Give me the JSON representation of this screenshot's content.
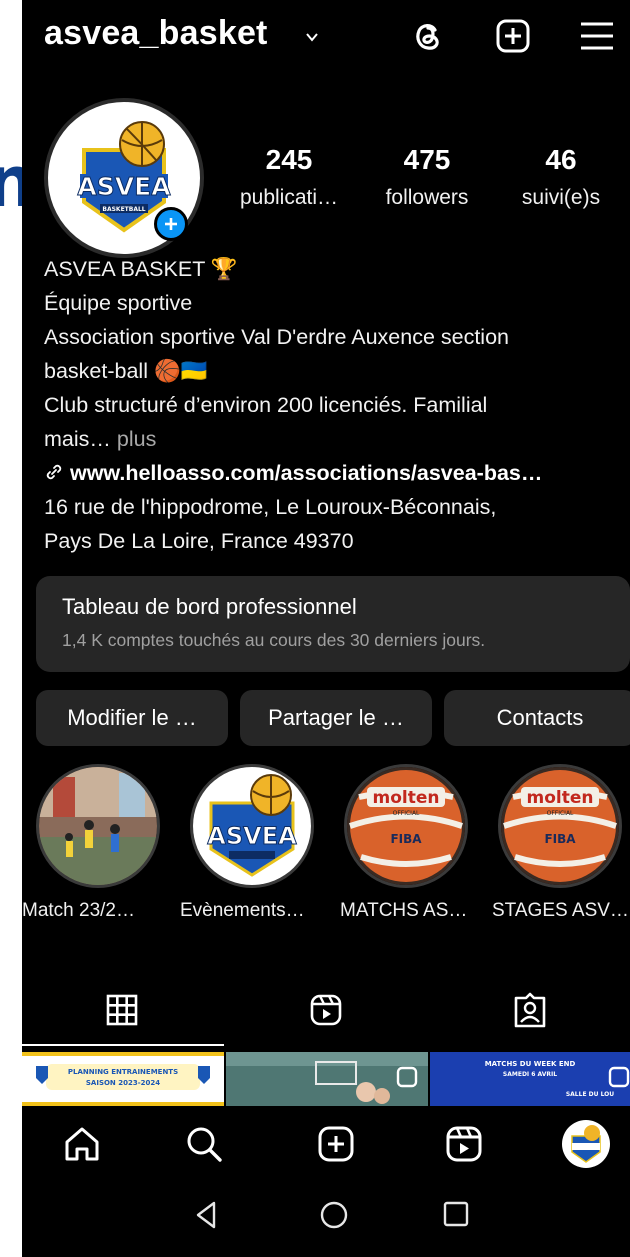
{
  "header": {
    "username": "asvea_basket"
  },
  "profile": {
    "stats": [
      {
        "value": "245",
        "label": "publicati…"
      },
      {
        "value": "475",
        "label": "followers"
      },
      {
        "value": "46",
        "label": "suivi(e)s"
      }
    ],
    "logo_text": "ASVEA",
    "logo_sub": "BASKETBALL"
  },
  "bio": {
    "name": "ASVEA BASKET 🏆",
    "category": "Équipe sportive",
    "line1": "Association sportive Val D'erdre Auxence section",
    "line2": "basket-ball 🏀🇺🇦",
    "line3": "Club structuré d’environ 200 licenciés. Familial",
    "line4": "mais…",
    "more": " plus",
    "link": "www.helloasso.com/associations/asvea-bas…",
    "address1": "16 rue de l'hippodrome, Le Louroux-Béconnais,",
    "address2": "Pays De La Loire, France 49370"
  },
  "dashboard": {
    "title": "Tableau de bord professionnel",
    "subtitle": "1,4 K comptes touchés au cours des 30 derniers jours."
  },
  "buttons": {
    "edit": "Modifier le …",
    "share": "Partager le …",
    "contacts": "Contacts"
  },
  "highlights": [
    {
      "label": "Match  23/2…"
    },
    {
      "label": "Evènements…"
    },
    {
      "label": "MATCHS AS…"
    },
    {
      "label": "STAGES ASV…"
    }
  ],
  "ball": {
    "brand": "molten",
    "official": "OFFICIAL",
    "fiba": "FIBA"
  },
  "grid": {
    "post1_line1": "PLANNING ENTRAINEMENTS",
    "post1_line2": "SAISON 2023-2024",
    "post3_line1": "MATCHS DU WEEK END",
    "post3_line2": "SAMEDI 6 AVRIL",
    "post3_line3": "SALLE DU LOU"
  },
  "colors": {
    "background": "#000000",
    "accent": "#0a95f6",
    "surface": "#262626"
  },
  "icons": {
    "top": [
      "threads-icon",
      "add-post-icon",
      "menu-icon"
    ],
    "tabs": [
      "grid-icon",
      "reels-icon",
      "tagged-icon"
    ],
    "nav": [
      "home-icon",
      "search-icon",
      "create-icon",
      "reels-icon",
      "profile-avatar"
    ]
  }
}
